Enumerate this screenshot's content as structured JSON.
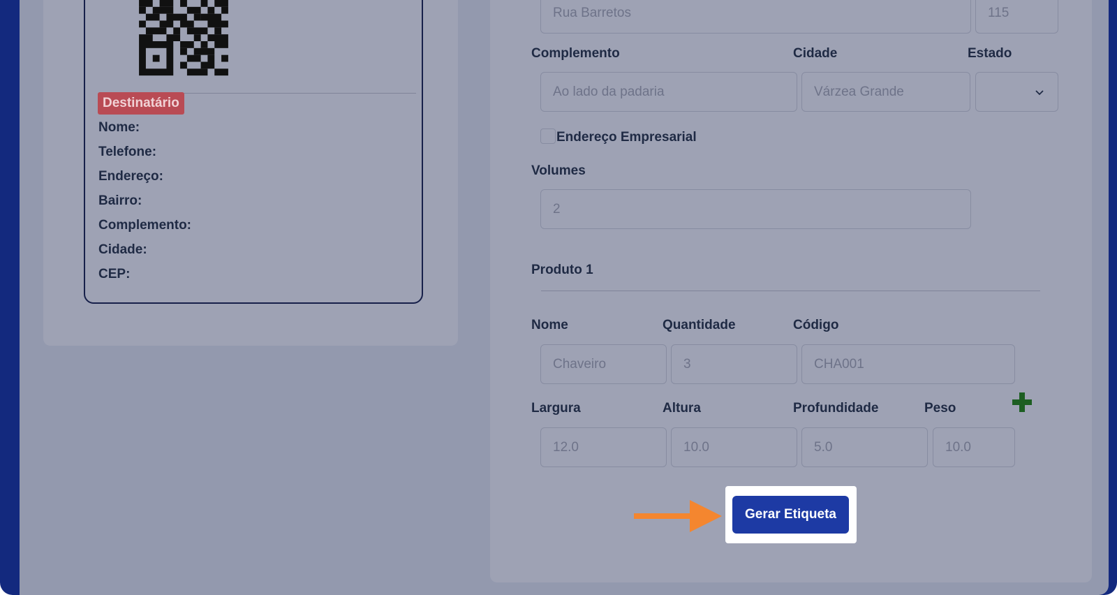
{
  "label_preview": {
    "recipient_badge": "Destinatário",
    "fields": [
      "Nome:",
      "Telefone:",
      "Endereço:",
      "Bairro:",
      "Complemento:",
      "Cidade:",
      "CEP:"
    ]
  },
  "form": {
    "street_value": "Rua Barretos",
    "number_value": "115",
    "complement_label": "Complemento",
    "complement_value": "Ao lado da padaria",
    "city_label": "Cidade",
    "city_value": "Várzea Grande",
    "state_label": "Estado",
    "state_value": "",
    "business_address_label": "Endereço Empresarial",
    "volumes_label": "Volumes",
    "volumes_value": "2",
    "product_title": "Produto 1",
    "product": {
      "name_label": "Nome",
      "name_value": "Chaveiro",
      "quantity_label": "Quantidade",
      "quantity_value": "3",
      "code_label": "Código",
      "code_value": "CHA001",
      "width_label": "Largura",
      "width_value": "12.0",
      "height_label": "Altura",
      "height_value": "10.0",
      "depth_label": "Profundidade",
      "depth_value": "5.0",
      "weight_label": "Peso",
      "weight_value": "10.0"
    },
    "submit_label": "Gerar Etiqueta"
  },
  "colors": {
    "primary": "#1d3aa4",
    "badge": "#b94b54",
    "arrow": "#f4862f",
    "plus": "#1d5e22"
  }
}
